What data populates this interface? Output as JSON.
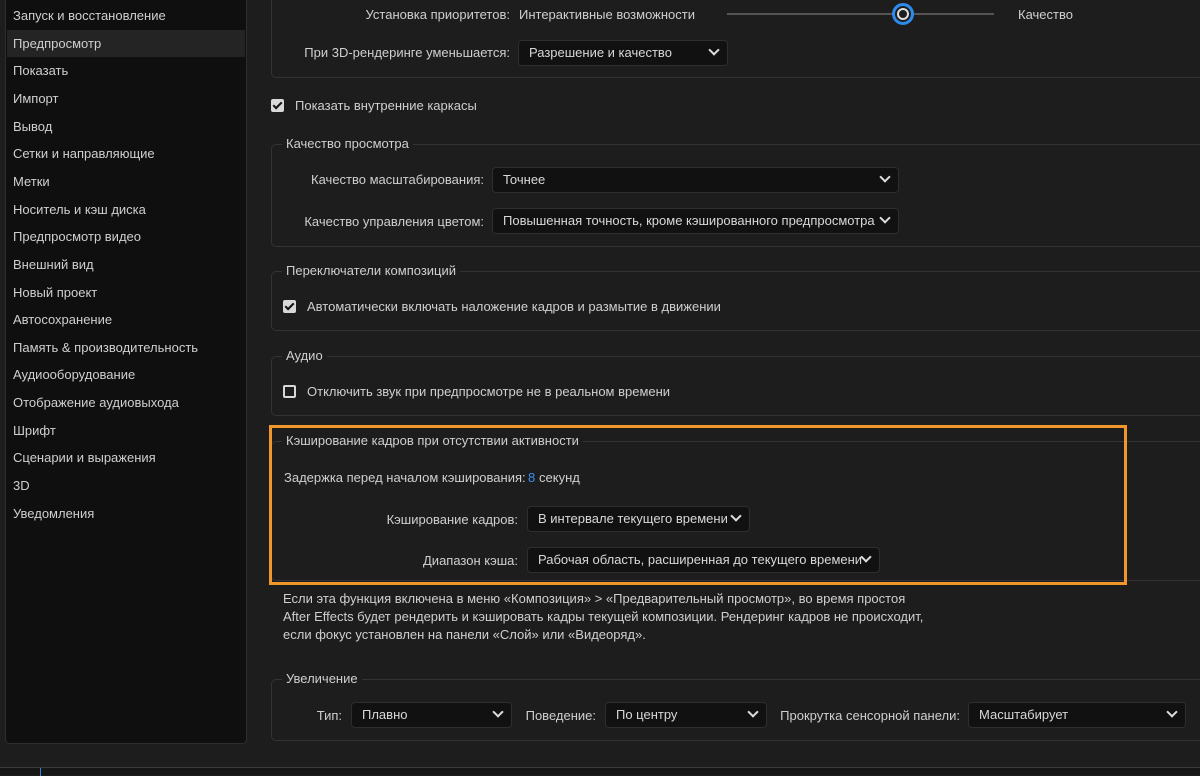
{
  "sidebar": {
    "items": [
      {
        "label": "Запуск и восстановление"
      },
      {
        "label": "Предпросмотр",
        "selected": true
      },
      {
        "label": "Показать"
      },
      {
        "label": "Импорт"
      },
      {
        "label": "Вывод"
      },
      {
        "label": "Сетки и направляющие"
      },
      {
        "label": "Метки"
      },
      {
        "label": "Носитель и кэш диска"
      },
      {
        "label": "Предпросмотр видео"
      },
      {
        "label": "Внешний вид"
      },
      {
        "label": "Новый проект"
      },
      {
        "label": "Автосохранение"
      },
      {
        "label": "Память & производительность"
      },
      {
        "label": "Аудиооборудование"
      },
      {
        "label": "Отображение аудиовыхода"
      },
      {
        "label": "Шрифт"
      },
      {
        "label": "Сценарии и выражения"
      },
      {
        "label": "3D"
      },
      {
        "label": "Уведомления"
      }
    ]
  },
  "top": {
    "priority_label": "Установка приоритетов:",
    "slider_left": "Интерактивные возможности",
    "slider_right": "Качество",
    "slider_value": 0.66,
    "reduce_label": "При 3D-рендеринге уменьшается:",
    "reduce_value": "Разрешение и качество"
  },
  "wireframes": {
    "label": "Показать внутренние каркасы",
    "checked": true
  },
  "view_quality": {
    "title": "Качество просмотра",
    "zoom_label": "Качество масштабирования:",
    "zoom_value": "Точнее",
    "color_label": "Качество управления цветом:",
    "color_value": "Повышенная точность, кроме кэшированного предпросмотра"
  },
  "comp_switches": {
    "title": "Переключатели композиций",
    "label": "Автоматически включать наложение кадров и размытие в движении",
    "checked": true
  },
  "audio": {
    "title": "Аудио",
    "label": "Отключить звук при предпросмотре не в реальном времени",
    "checked": false
  },
  "idle_cache": {
    "title": "Кэширование кадров при отсутствии активности",
    "delay_label": "Задержка перед началом кэширования:",
    "delay_value": "8",
    "delay_unit": "секунд",
    "frames_label": "Кэширование кадров:",
    "frames_value": "В интервале текущего времени",
    "range_label": "Диапазон кэша:",
    "range_value": "Рабочая область, расширенная до текущего времени",
    "highlight_color": "#f0962a"
  },
  "description": [
    "Если эта функция включена в меню «Композиция» > «Предварительный просмотр», во время простоя",
    "After Effects будет рендерить и кэшировать кадры текущей композиции. Рендеринг кадров не происходит,",
    "если фокус установлен на панели «Слой» или «Видеоряд»."
  ],
  "zoom": {
    "title": "Увеличение",
    "type_label": "Тип:",
    "type_value": "Плавно",
    "behavior_label": "Поведение:",
    "behavior_value": "По центру",
    "touch_label": "Прокрутка сенсорной панели:",
    "touch_value": "Масштабирует"
  }
}
